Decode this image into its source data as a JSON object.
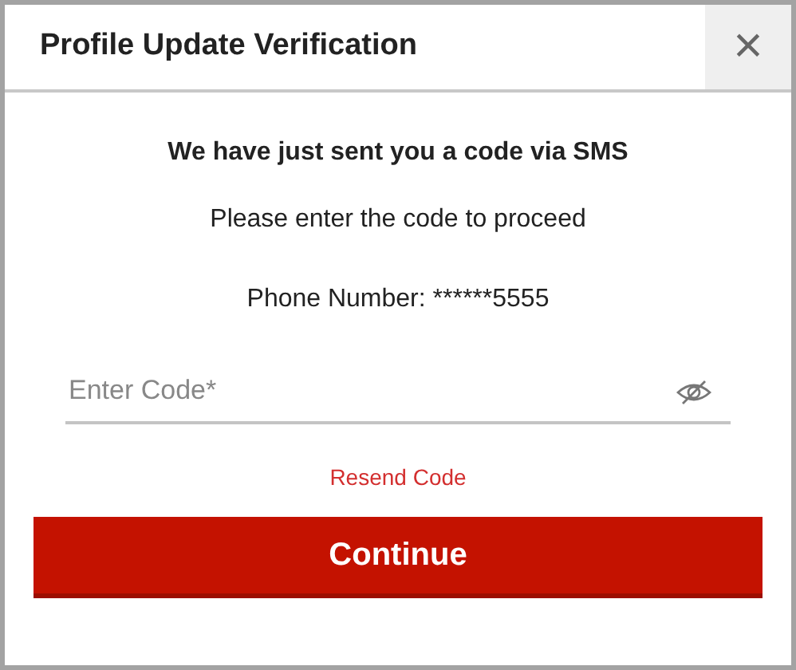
{
  "dialog": {
    "title": "Profile Update Verification",
    "close": "×"
  },
  "body": {
    "heading": "We have just sent you a code via SMS",
    "instruction": "Please enter the code to proceed",
    "phone": "Phone Number: ******5555"
  },
  "code_field": {
    "placeholder": "Enter Code*",
    "masked": true
  },
  "resend_link": "Resend Code",
  "continue_button": "Continue"
}
